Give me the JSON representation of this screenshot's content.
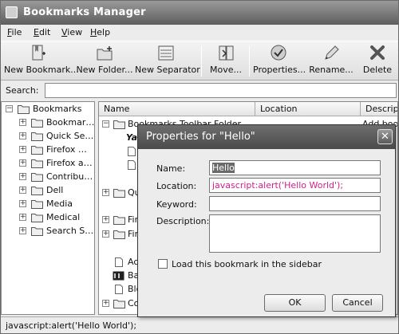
{
  "window": {
    "title": "Bookmarks Manager"
  },
  "menu": [
    {
      "label": "File",
      "mnemonic": "F",
      "rest": "ile"
    },
    {
      "label": "Edit",
      "mnemonic": "E",
      "rest": "dit"
    },
    {
      "label": "View",
      "mnemonic": "V",
      "rest": "iew"
    },
    {
      "label": "Help",
      "mnemonic": "H",
      "rest": "elp"
    }
  ],
  "toolbar": {
    "new_bookmark": "New Bookmark...",
    "new_folder": "New Folder...",
    "new_separator": "New Separator",
    "move": "Move...",
    "properties": "Properties...",
    "rename": "Rename...",
    "delete": "Delete"
  },
  "search": {
    "label": "Search:",
    "value": ""
  },
  "tree": {
    "root": "Bookmarks",
    "items": [
      "Bookmar…",
      "Quick Se…",
      "Firefox …",
      "Firefox a…",
      "Contribu…",
      "Dell",
      "Media",
      "Medical",
      "Search S…"
    ]
  },
  "list": {
    "columns": [
      "Name",
      "Location",
      "Descriptio"
    ],
    "rows": [
      {
        "name": "Bookmarks Toolbar Folder",
        "location": "",
        "description": "Add bookm"
      },
      {
        "name": "Ya",
        "location": "",
        "description": ""
      },
      {
        "name": "",
        "location": "",
        "description": ""
      },
      {
        "name": "",
        "location": "",
        "description": ""
      },
      {
        "name": "Qu",
        "location": "",
        "description": ""
      },
      {
        "name": "Fire",
        "location": "",
        "description": ""
      },
      {
        "name": "Fire",
        "location": "",
        "description": ""
      },
      {
        "name": "Acc",
        "location": "",
        "description": ""
      },
      {
        "name": "Bac",
        "location": "",
        "description": ""
      },
      {
        "name": "Blo",
        "location": "",
        "description": ""
      },
      {
        "name": "Co",
        "location": "",
        "description": ""
      }
    ]
  },
  "status": {
    "text": "javascript:alert('Hello World');"
  },
  "dialog": {
    "title": "Properties for \"Hello\"",
    "name_label": "Name:",
    "name_value": "Hello",
    "location_label": "Location:",
    "location_value": "javascript:alert('Hello World');",
    "keyword_label": "Keyword:",
    "keyword_value": "",
    "description_label": "Description:",
    "description_value": "",
    "sidebar_checkbox_label": "Load this bookmark in the sidebar",
    "sidebar_checked": false,
    "ok_label": "OK",
    "cancel_label": "Cancel",
    "close_glyph": "✕"
  },
  "colors": {
    "location_text": "#cc2288",
    "selection": "#6a6a6a",
    "titlebar": "#6e6e6e"
  }
}
